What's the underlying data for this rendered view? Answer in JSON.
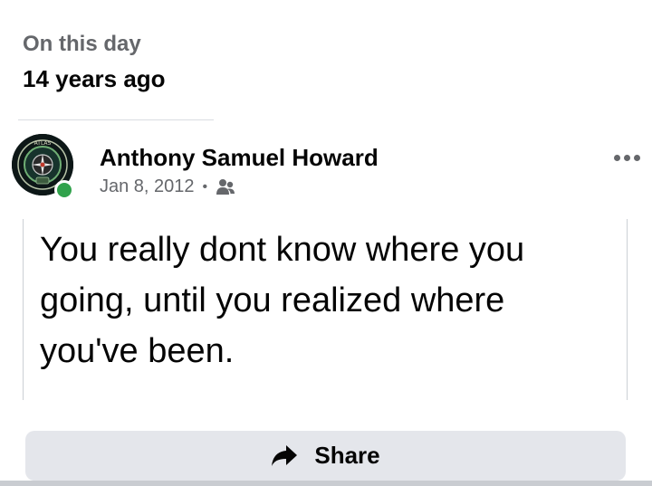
{
  "memory": {
    "label": "On this day",
    "years_ago": "14 years ago"
  },
  "post": {
    "author": "Anthony Samuel Howard",
    "date": "Jan 8, 2012",
    "separator": "•",
    "audience_icon": "friends-icon",
    "text": "You really dont know where you going, until you realized where you've been.",
    "online_status_color": "#31a24c",
    "avatar_badge_text": "ATLAS"
  },
  "actions": {
    "more_icon": "more-options-icon",
    "share_label": "Share",
    "share_icon": "share-arrow-icon"
  }
}
